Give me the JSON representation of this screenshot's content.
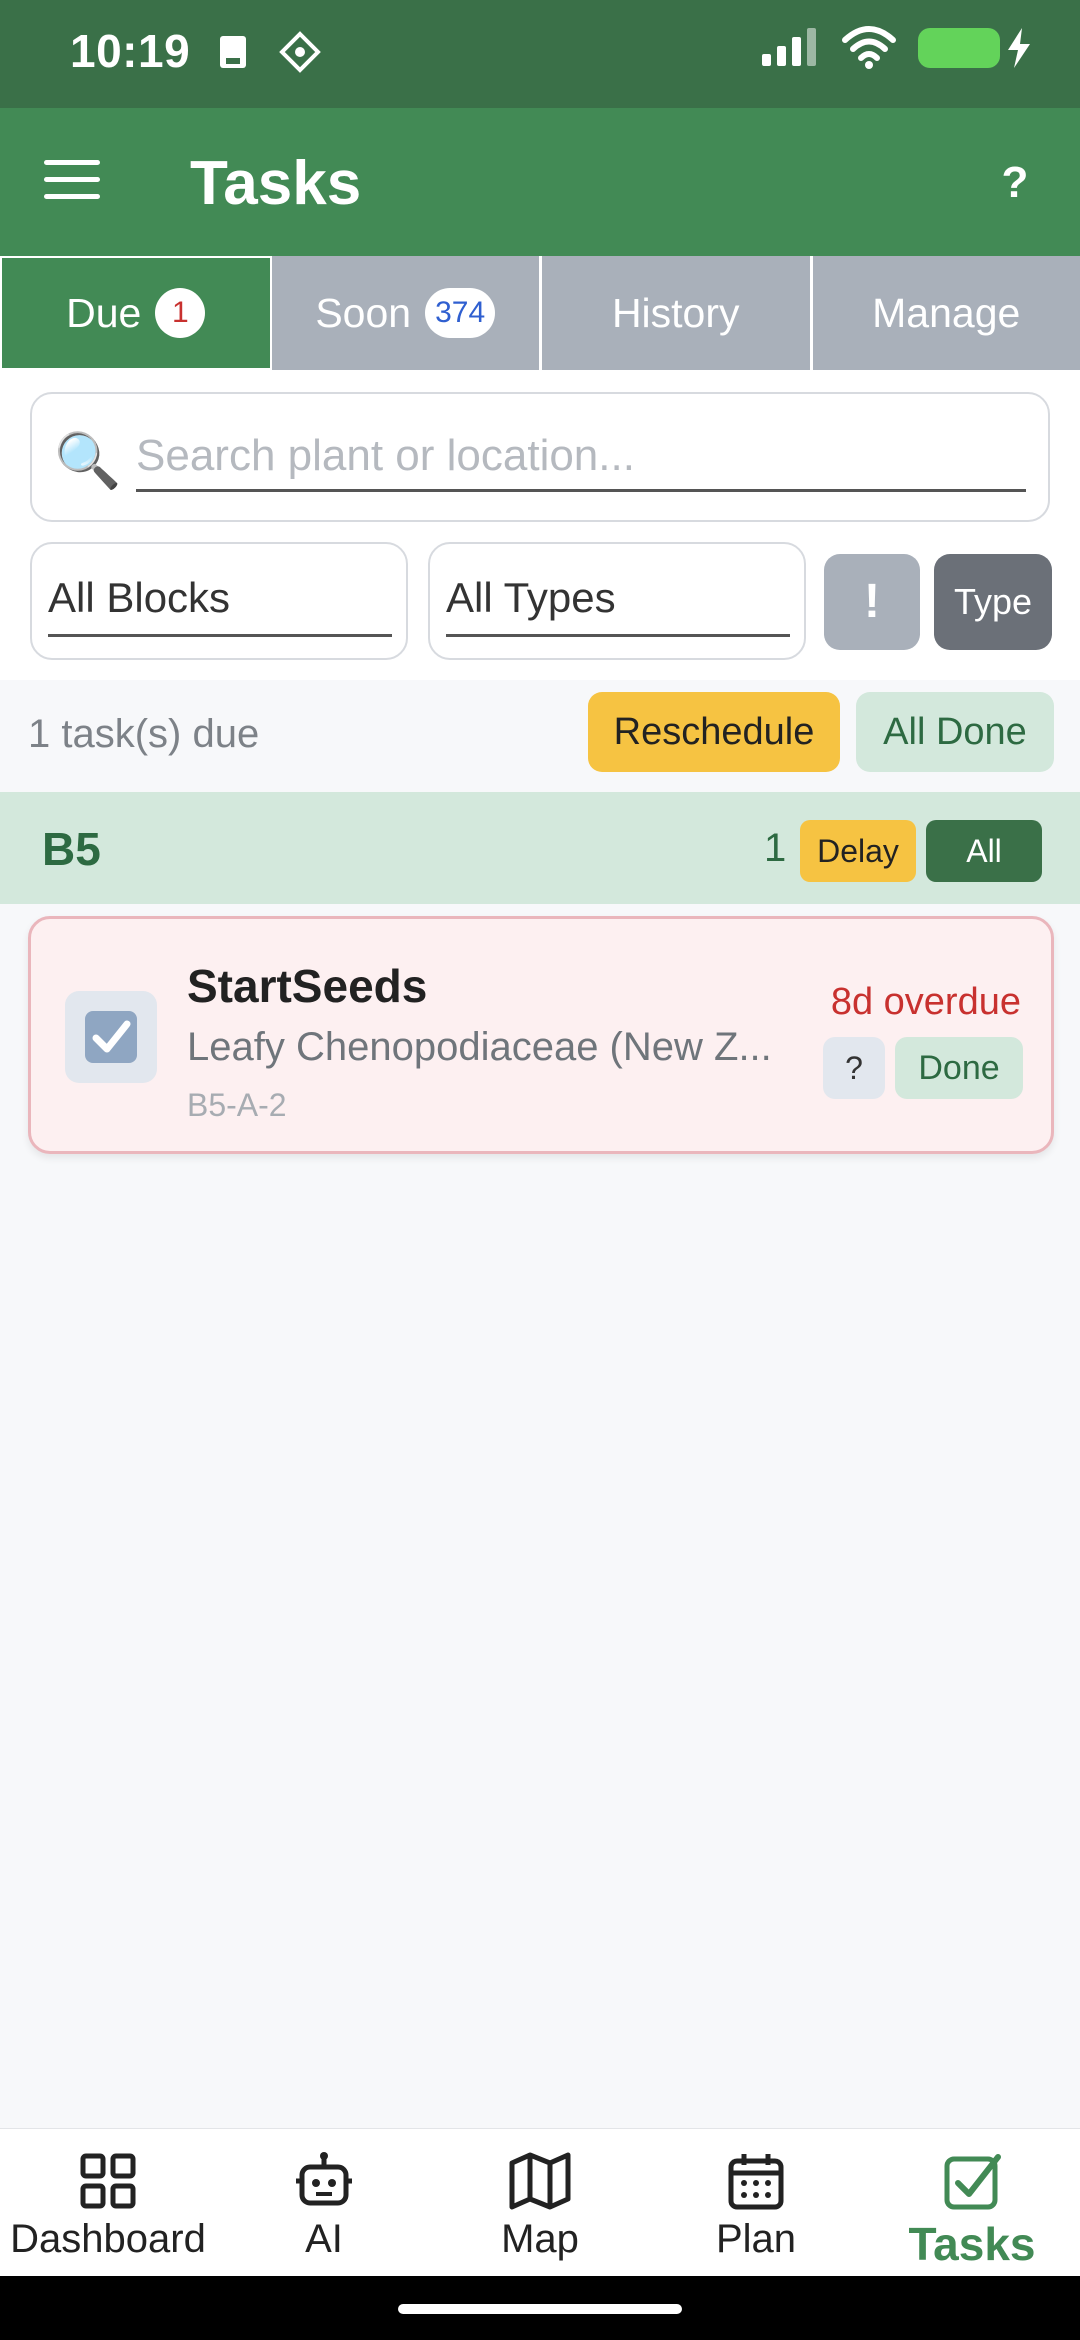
{
  "status_bar": {
    "time": "10:19"
  },
  "app_bar": {
    "title": "Tasks",
    "help_label": "?"
  },
  "tabs": [
    {
      "label": "Due",
      "badge": "1",
      "active": true
    },
    {
      "label": "Soon",
      "badge": "374",
      "active": false
    },
    {
      "label": "History",
      "active": false
    },
    {
      "label": "Manage",
      "active": false
    }
  ],
  "filters": {
    "search_placeholder": "Search plant or location...",
    "block_select": "All Blocks",
    "type_select": "All Types",
    "priority_button": "!",
    "type_button": "Type"
  },
  "summary": {
    "due_text": "1 task(s) due",
    "reschedule_label": "Reschedule",
    "all_done_label": "All Done"
  },
  "groups": [
    {
      "name": "B5",
      "count": "1",
      "delay_label": "Delay",
      "all_label": "All",
      "tasks": [
        {
          "title": "StartSeeds",
          "plant": "Leafy Chenopodiaceae (New Z...",
          "location": "B5-A-2",
          "overdue": "8d overdue",
          "info_label": "?",
          "done_label": "Done"
        }
      ]
    }
  ],
  "bottom_nav": [
    {
      "label": "Dashboard",
      "icon": "dashboard-grid-icon",
      "active": false
    },
    {
      "label": "AI",
      "icon": "robot-icon",
      "active": false
    },
    {
      "label": "Map",
      "icon": "map-icon",
      "active": false
    },
    {
      "label": "Plan",
      "icon": "calendar-icon",
      "active": false
    },
    {
      "label": "Tasks",
      "icon": "checkbox-icon",
      "active": true
    }
  ],
  "colors": {
    "primary_green": "#428a55",
    "dark_green": "#3a7048",
    "light_green": "#d3e8dc",
    "yellow": "#f6c342",
    "overdue_red": "#c8312f",
    "tab_inactive": "#a9b0ba"
  }
}
